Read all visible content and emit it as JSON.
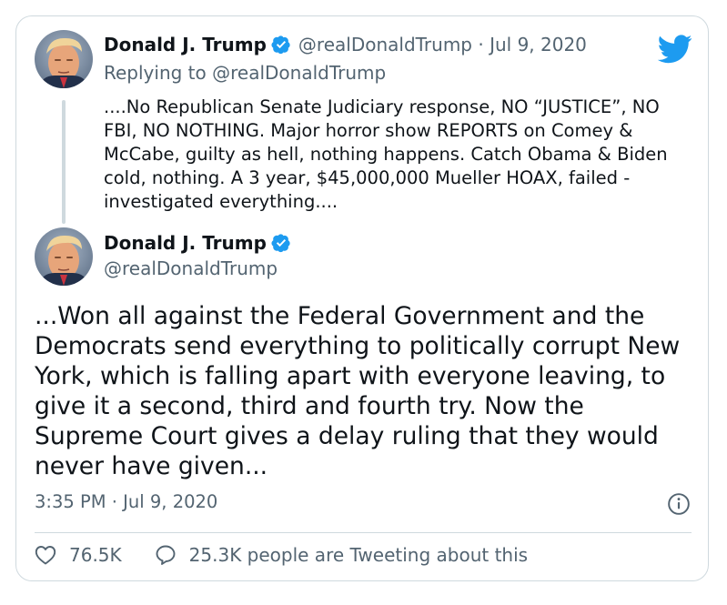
{
  "parent_tweet": {
    "display_name": "Donald J. Trump",
    "handle": "@realDonaldTrump",
    "date": "Jul 9, 2020",
    "separator": "·",
    "replying_to_prefix": "Replying to ",
    "replying_to_handle": "@realDonaldTrump",
    "text": "....No Republican Senate Judiciary response, NO “JUSTICE”, NO FBI, NO NOTHING. Major horror show REPORTS on Comey & McCabe, guilty as hell, nothing happens. Catch Obama & Biden cold, nothing. A 3 year, $45,000,000 Mueller HOAX, failed - investigated everything...."
  },
  "main_tweet": {
    "display_name": "Donald J. Trump",
    "handle": "@realDonaldTrump",
    "text": "...Won all against the Federal Government and the Democrats send everything to politically corrupt New York, which is falling apart with everyone leaving, to give it a second, third and fourth try. Now the Supreme Court gives a delay ruling that they would never have given...",
    "timestamp": "3:35 PM · Jul 9, 2020"
  },
  "actions": {
    "likes": "76.5K",
    "retweets_text": "25.3K people are Tweeting about this"
  },
  "icons": {
    "brand": "twitter-bird-icon",
    "verified": "verified-badge-icon",
    "info": "info-icon",
    "like": "heart-icon",
    "reply": "speech-bubble-icon"
  },
  "colors": {
    "brand_blue": "#1d9bf0",
    "text_primary": "#0f1419",
    "text_secondary": "#536471",
    "border": "#cfd9de"
  }
}
